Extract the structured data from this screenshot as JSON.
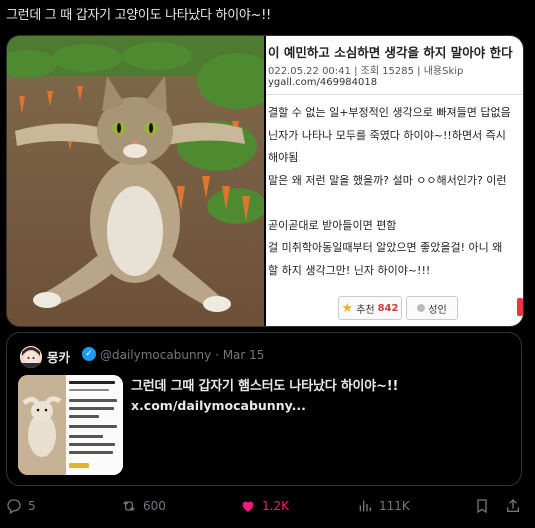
{
  "tweet": {
    "text": "그런데 그 때 갑자기 고양이도 나타났다 하이야~!!"
  },
  "post_capture": {
    "title": "이 예민하고 소심하면 생각을 하지 말아야 한다",
    "meta": "022.05.22 00:41 | 조회 15285 | 내용Skip",
    "url": "ygall.com/469984018",
    "lines": [
      "결할 수 없는 일+부정적인 생각으로 빠져들면 답없음",
      "닌자가 나타나 모두를 죽였다 하이야~!!하면서 즉시",
      "해야됨",
      "말은 왜 저런 말을 했을까? 설마 ㅇㅇ해서인가? 이런",
      "",
      "곧이곧대로 받아들이면 편함",
      "걸 미취학아동일때부터 알았으면 좋았을걸! 아니 왜",
      "할 하지 생각그만! 닌자 하이야~!!!"
    ],
    "recommend_label": "추천",
    "recommend_count": "842",
    "adult_label": "성인"
  },
  "quote": {
    "name": "몽카",
    "handle": "@dailymocabunny · Mar 15",
    "text": "그런데 그때 갑자기 햄스터도 나타났다 하이야~!!",
    "link": "x.com/dailymocabunny..."
  },
  "actions": {
    "replies": "5",
    "reposts": "600",
    "likes": "1.2K",
    "views": "111K"
  },
  "colors": {
    "background": "#000000",
    "text": "#e7e9ea",
    "muted": "#71767b",
    "like": "#f91880",
    "verified": "#1d9bf0"
  },
  "icons": [
    "reply-icon",
    "repost-icon",
    "heart-icon",
    "views-icon",
    "bookmark-icon",
    "share-icon",
    "verified-icon",
    "star-icon"
  ]
}
